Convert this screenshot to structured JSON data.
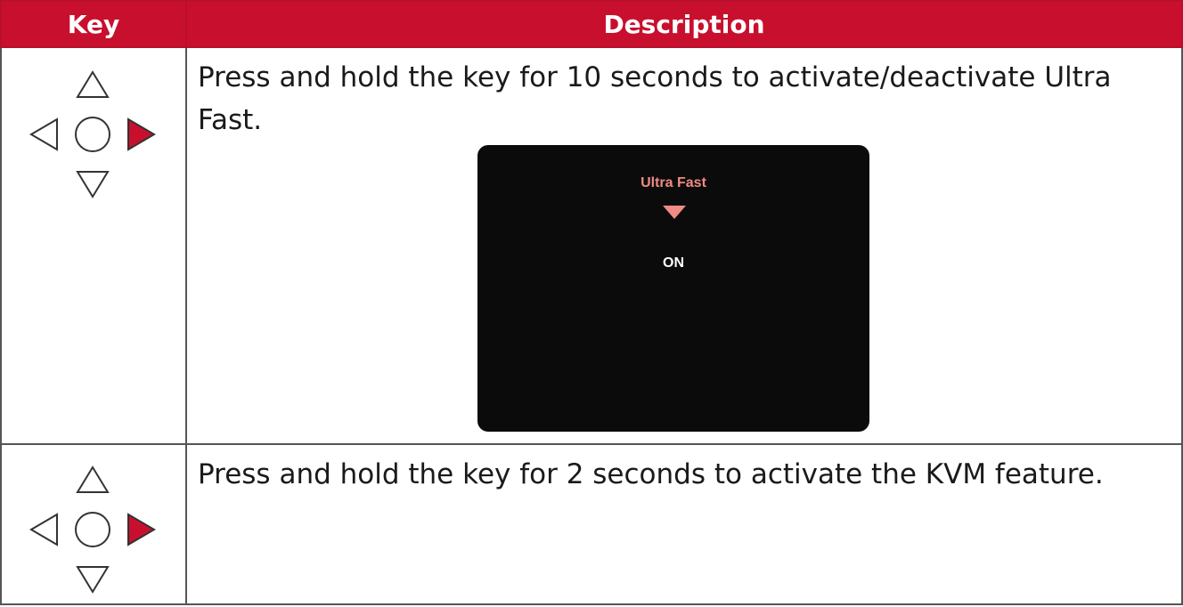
{
  "table": {
    "header_key": "Key",
    "header_description": "Description"
  },
  "rows": [
    {
      "description": "Press and hold the key for 10 seconds to activate/deactivate Ultra Fast.",
      "highlighted_key": "right",
      "osd": {
        "title": "Ultra Fast",
        "value": "ON"
      }
    },
    {
      "description": "Press and hold the key for 2 seconds to activate the KVM feature.",
      "highlighted_key": "right"
    }
  ],
  "colors": {
    "header_bg": "#c8102e",
    "highlight_key": "#c8102e",
    "osd_bg": "#0b0b0b",
    "osd_accent": "#f08a84"
  },
  "icons": [
    "up-arrow-icon",
    "down-arrow-icon",
    "left-arrow-icon",
    "right-arrow-icon",
    "center-button-icon"
  ]
}
